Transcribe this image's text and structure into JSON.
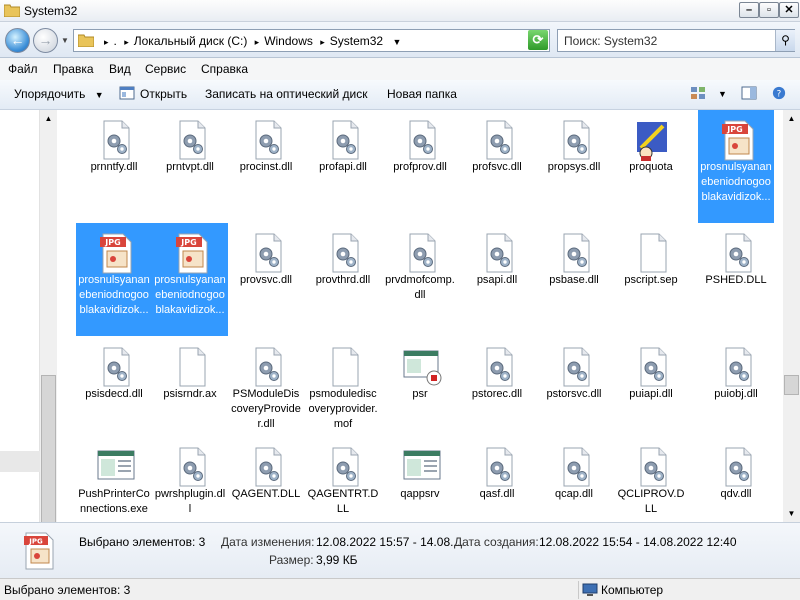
{
  "window": {
    "title": "System32"
  },
  "address": {
    "crumbs": [
      "Локальный диск (C:)",
      "Windows",
      "System32"
    ],
    "search_placeholder": "Поиск: System32"
  },
  "menu": [
    "Файл",
    "Правка",
    "Вид",
    "Сервис",
    "Справка"
  ],
  "toolbar": {
    "organize": "Упорядочить",
    "open": "Открыть",
    "burn": "Записать на оптический диск",
    "new_folder": "Новая папка"
  },
  "files": [
    {
      "name": "prnntfy.dll",
      "icon": "dll-gear-icon",
      "selected": false
    },
    {
      "name": "prntvpt.dll",
      "icon": "dll-gear-icon",
      "selected": false
    },
    {
      "name": "procinst.dll",
      "icon": "dll-gear-icon",
      "selected": false
    },
    {
      "name": "profapi.dll",
      "icon": "dll-gear-icon",
      "selected": false
    },
    {
      "name": "profprov.dll",
      "icon": "dll-gear-icon",
      "selected": false
    },
    {
      "name": "profsvc.dll",
      "icon": "dll-gear-icon",
      "selected": false
    },
    {
      "name": "propsys.dll",
      "icon": "dll-gear-icon",
      "selected": false
    },
    {
      "name": "proquota",
      "icon": "quota-app-icon",
      "selected": false
    },
    {
      "name": "prosnulsyananebeniodnogooblakavidizok...",
      "icon": "jpg-file-icon",
      "selected": true
    },
    {
      "name": "prosnulsyananebeniodnogooblakavidizok...",
      "icon": "jpg-file-icon",
      "selected": true
    },
    {
      "name": "prosnulsyananebeniodnogooblakavidizok...",
      "icon": "jpg-file-icon",
      "selected": true
    },
    {
      "name": "provsvc.dll",
      "icon": "dll-gear-icon",
      "selected": false
    },
    {
      "name": "provthrd.dll",
      "icon": "dll-gear-icon",
      "selected": false
    },
    {
      "name": "prvdmofcomp.dll",
      "icon": "dll-gear-icon",
      "selected": false
    },
    {
      "name": "psapi.dll",
      "icon": "dll-gear-icon",
      "selected": false
    },
    {
      "name": "psbase.dll",
      "icon": "dll-gear-icon",
      "selected": false
    },
    {
      "name": "pscript.sep",
      "icon": "blank-file-icon",
      "selected": false
    },
    {
      "name": "PSHED.DLL",
      "icon": "dll-gear-icon",
      "selected": false
    },
    {
      "name": "psisdecd.dll",
      "icon": "dll-gear-icon",
      "selected": false
    },
    {
      "name": "psisrndr.ax",
      "icon": "blank-file-icon",
      "selected": false
    },
    {
      "name": "PSModuleDiscoveryProvider.dll",
      "icon": "dll-gear-icon",
      "selected": false
    },
    {
      "name": "psmodulediscoveryprovider.mof",
      "icon": "blank-file-icon",
      "selected": false
    },
    {
      "name": "psr",
      "icon": "recorder-app-icon",
      "selected": false
    },
    {
      "name": "pstorec.dll",
      "icon": "dll-gear-icon",
      "selected": false
    },
    {
      "name": "pstorsvc.dll",
      "icon": "dll-gear-icon",
      "selected": false
    },
    {
      "name": "puiapi.dll",
      "icon": "dll-gear-icon",
      "selected": false
    },
    {
      "name": "puiobj.dll",
      "icon": "dll-gear-icon",
      "selected": false
    },
    {
      "name": "PushPrinterConnections.exe",
      "icon": "app-window-icon",
      "selected": false
    },
    {
      "name": "pwrshplugin.dll",
      "icon": "dll-gear-icon",
      "selected": false
    },
    {
      "name": "QAGENT.DLL",
      "icon": "dll-gear-icon",
      "selected": false
    },
    {
      "name": "QAGENTRT.DLL",
      "icon": "dll-gear-icon",
      "selected": false
    },
    {
      "name": "qappsrv",
      "icon": "app-window-icon",
      "selected": false
    },
    {
      "name": "qasf.dll",
      "icon": "dll-gear-icon",
      "selected": false
    },
    {
      "name": "qcap.dll",
      "icon": "dll-gear-icon",
      "selected": false
    },
    {
      "name": "QCLIPROV.DLL",
      "icon": "dll-gear-icon",
      "selected": false
    },
    {
      "name": "qdv.dll",
      "icon": "dll-gear-icon",
      "selected": false
    }
  ],
  "details": {
    "selected": "Выбрано элементов: 3",
    "modified_label": "Дата изменения:",
    "modified_value": "12.08.2022 15:57 - 14.08....",
    "created_label": "Дата создания:",
    "created_value": "12.08.2022 15:54 - 14.08.2022 12:40",
    "size_label": "Размер:",
    "size_value": "3,99 КБ"
  },
  "status": {
    "left": "Выбрано элементов: 3",
    "right": "Компьютер"
  }
}
